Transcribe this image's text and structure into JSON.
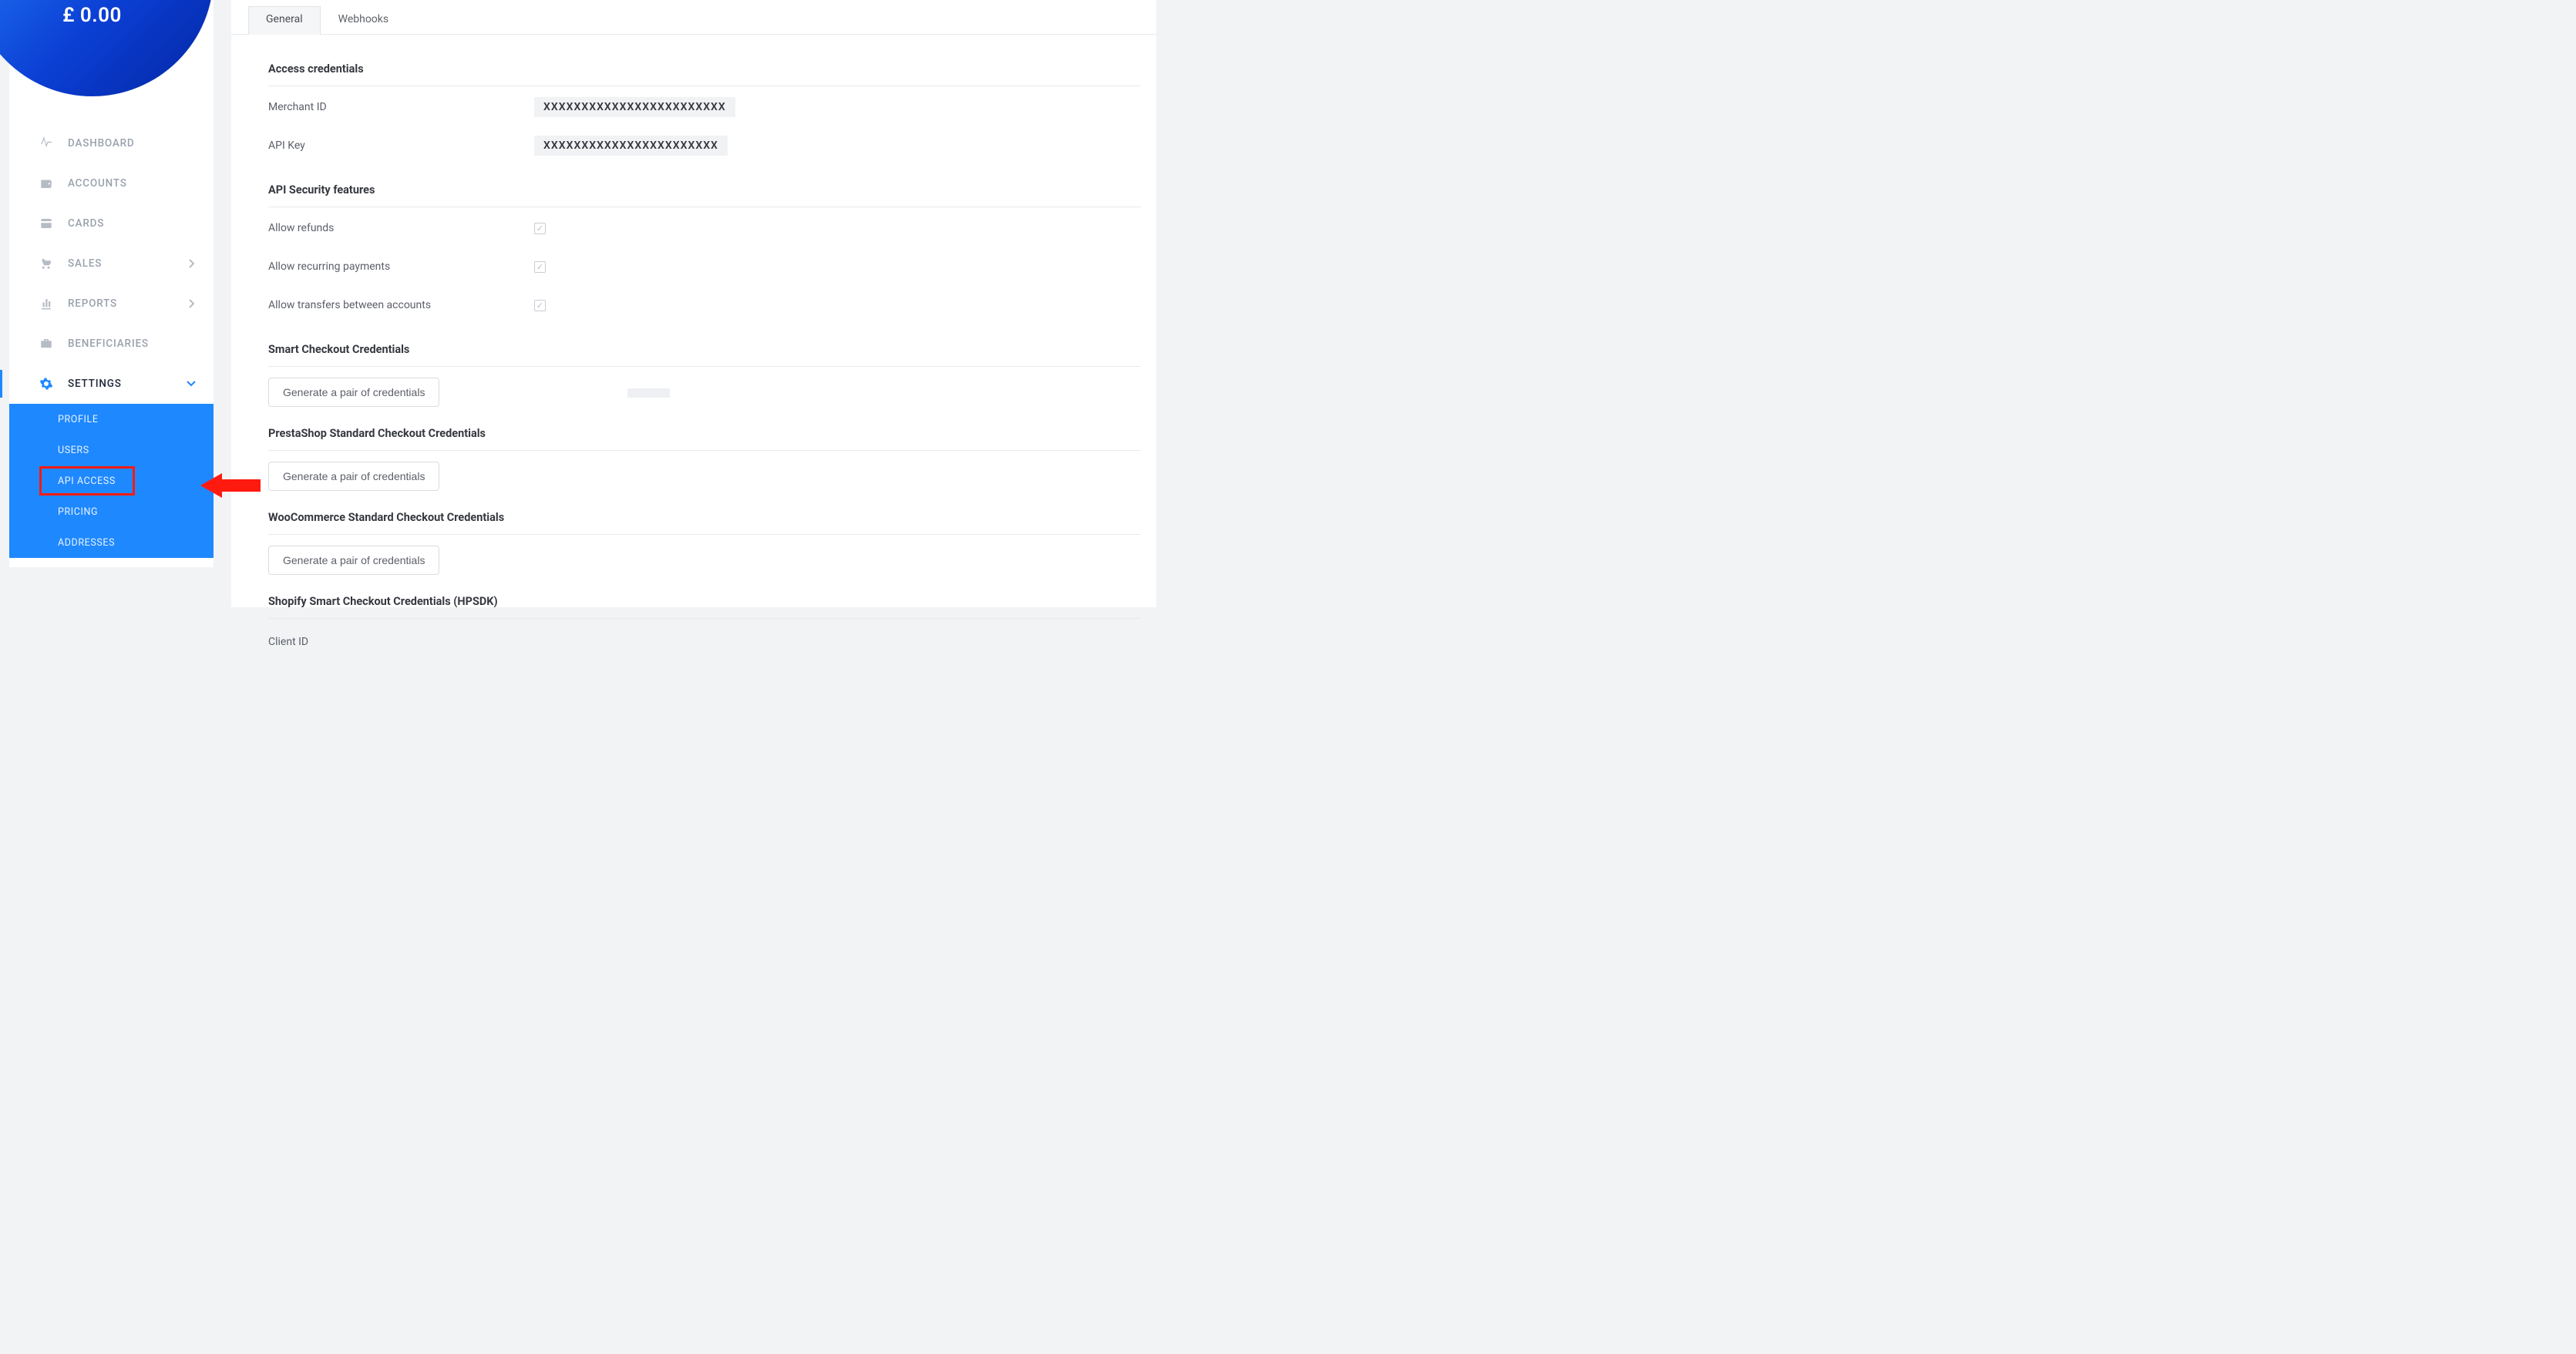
{
  "balance": "£ 0.00",
  "sidebar": {
    "items": {
      "dashboard": "DASHBOARD",
      "accounts": "ACCOUNTS",
      "cards": "CARDS",
      "sales": "SALES",
      "reports": "REPORTS",
      "beneficiaries": "BENEFICIARIES",
      "settings": "SETTINGS"
    },
    "sub": {
      "profile": "PROFILE",
      "users": "USERS",
      "api_access": "API ACCESS",
      "pricing": "PRICING",
      "addresses": "ADDRESSES"
    }
  },
  "tabs": {
    "general": "General",
    "webhooks": "Webhooks"
  },
  "sections": {
    "access_cred": "Access credentials",
    "api_sec": "API Security features",
    "smart_co": "Smart Checkout Credentials",
    "presta": "PrestaShop Standard Checkout Credentials",
    "woo": "WooCommerce Standard Checkout Credentials",
    "shopify": "Shopify Smart Checkout Credentials (HPSDK)"
  },
  "labels": {
    "merchant_id": "Merchant ID",
    "api_key": "API Key",
    "allow_refunds": "Allow refunds",
    "allow_recurring": "Allow recurring payments",
    "allow_transfers": "Allow transfers between accounts",
    "client_id": "Client ID",
    "gen_btn": "Generate a pair of credentials"
  },
  "values": {
    "merchant_id": "XXXXXXXXXXXXXXXXXXXXXXXX",
    "api_key": "XXXXXXXXXXXXXXXXXXXXXXX",
    "allow_refunds": true,
    "allow_recurring": true,
    "allow_transfers": true
  },
  "annotation": {
    "color": "#ff1a10",
    "target": "API ACCESS"
  }
}
